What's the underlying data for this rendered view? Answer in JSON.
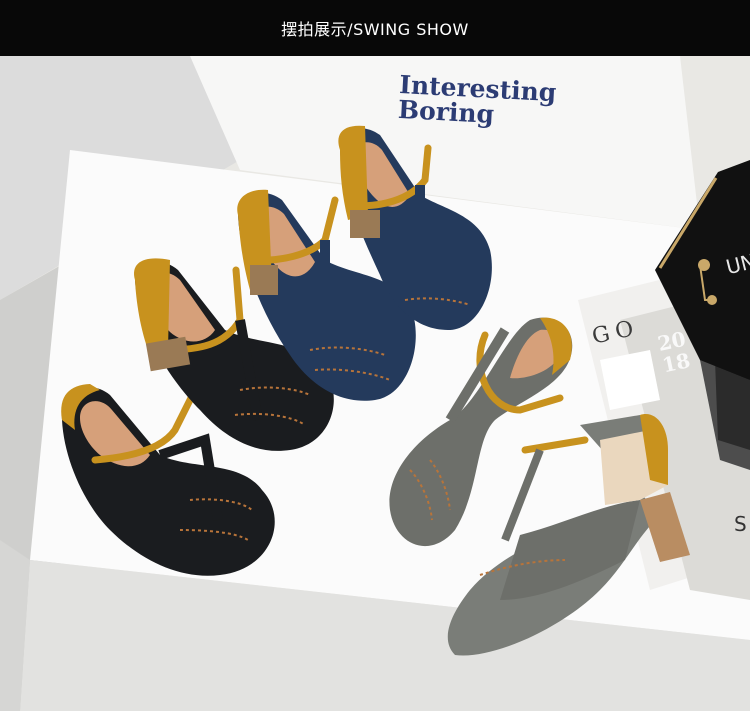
{
  "header": {
    "title": "摆拍展示/SWING SHOW"
  },
  "scene": {
    "box_print": {
      "line1": "Interesting",
      "line2": "Boring"
    },
    "magazine_letters": "GO",
    "magazine_year": {
      "line1": "20",
      "line2": "18"
    },
    "bag_letters": "UN",
    "magazine_edge_letter": "S"
  },
  "colors": {
    "header_bg": "#080808",
    "box_text": "#2c3c74",
    "shoe_black": "#1a1c1f",
    "shoe_navy": "#243a5c",
    "shoe_grey": "#6d6f6a",
    "strap_mustard": "#c8921e",
    "stitch_tan": "#b8743a"
  }
}
